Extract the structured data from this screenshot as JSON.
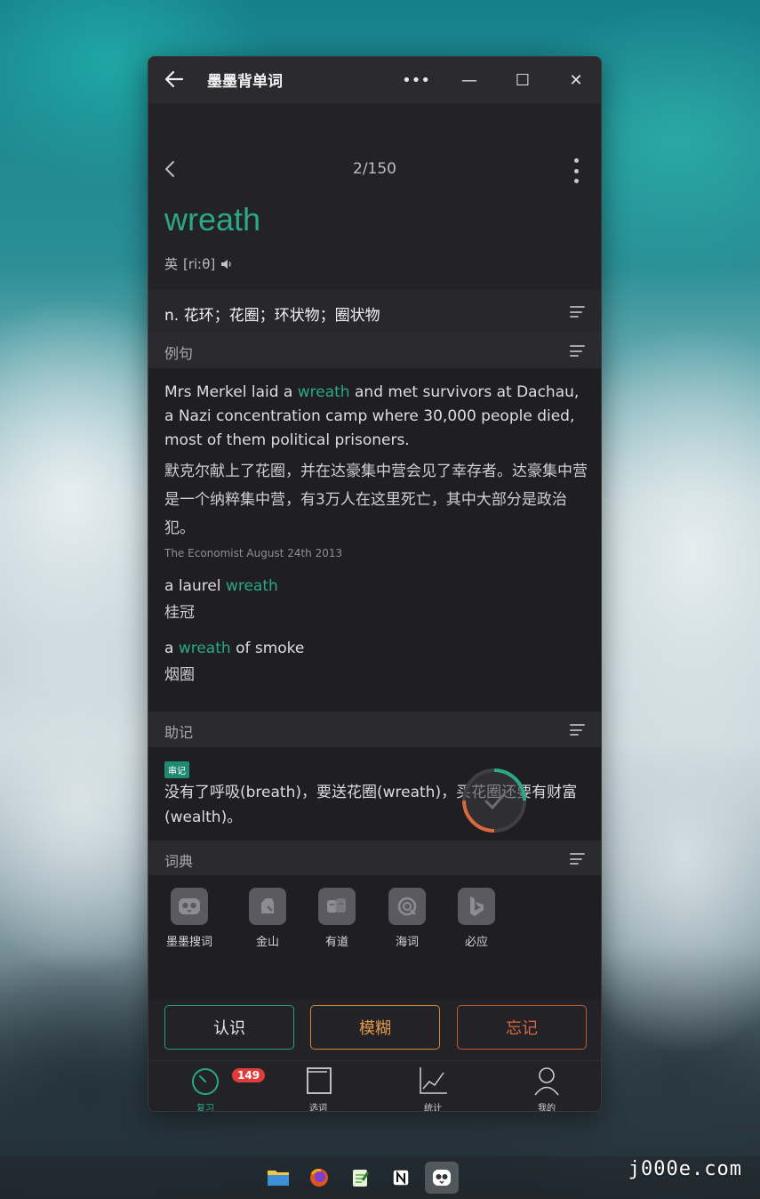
{
  "app": {
    "title": "墨墨背单词"
  },
  "window_controls": {
    "more": "•••",
    "minimize": "—",
    "maximize": "☐",
    "close": "✕"
  },
  "nav": {
    "counter": "2/150"
  },
  "word": {
    "text": "wreath",
    "phonetic_region": "英",
    "phonetic": "[riːθ]"
  },
  "definition": "n. 花环；花圈；环状物；圈状物",
  "sections": {
    "examples": "例句",
    "mnemonic": "助记",
    "dictionary": "词典"
  },
  "examples": {
    "main": {
      "en_before": "Mrs Merkel laid a ",
      "en_highlight": "wreath",
      "en_after": " and met survivors at Dachau, a Nazi concentration camp where 30,000 people died, most of them political prisoners.",
      "zh": "默克尔献上了花圈，并在达豪集中营会见了幸存者。达豪集中营是一个纳粹集中营，有3万人在这里死亡，其中大部分是政治犯。",
      "source": "The Economist August 24th 2013"
    },
    "phrases": [
      {
        "before": "a laurel ",
        "highlight": "wreath",
        "after": "",
        "zh": "桂冠"
      },
      {
        "before": "a ",
        "highlight": "wreath",
        "after": " of smoke",
        "zh": "烟圈"
      }
    ]
  },
  "mnemonic": {
    "tag": "串记",
    "text": "没有了呼吸(breath)，要送花圈(wreath)，买花圈还要有财富(wealth)。"
  },
  "dictionaries": [
    {
      "label": "墨墨搜词",
      "icon": "owl-icon"
    },
    {
      "label": "金山",
      "icon": "jinshan-icon"
    },
    {
      "label": "有道",
      "icon": "youdao-icon"
    },
    {
      "label": "海词",
      "icon": "haici-icon"
    },
    {
      "label": "必应",
      "icon": "bing-icon"
    }
  ],
  "actions": {
    "know": "认识",
    "fuzzy": "模糊",
    "forget": "忘记"
  },
  "bottom_nav": {
    "review": "复习",
    "review_badge": "149",
    "select": "选词",
    "stats": "统计",
    "me": "我的"
  },
  "watermark": "j000e.com",
  "colors": {
    "accent": "#2aa889",
    "fuzzy": "#e39a4a",
    "forget": "#d9683f",
    "badge": "#e23b3b"
  }
}
